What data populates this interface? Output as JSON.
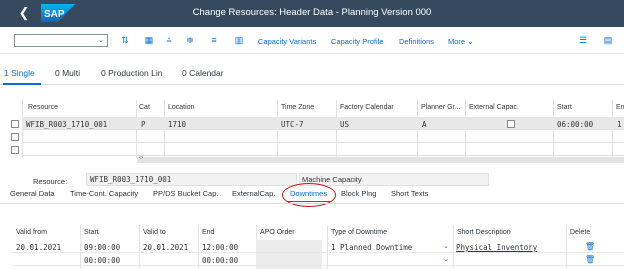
{
  "shell": {
    "title": "Change Resources: Header Data - Planning Version 000",
    "logo_text": "SAP"
  },
  "toolbar": {
    "combo_value": "",
    "capacity_variants": "Capacity Variants",
    "capacity_profile": "Capacity Profile",
    "definitions": "Definitions",
    "more": "More"
  },
  "count_tabs": [
    {
      "label": "1 Single"
    },
    {
      "label": "0 Multi"
    },
    {
      "label": "0 Production Lin"
    },
    {
      "label": "0 Calendar"
    }
  ],
  "grid": {
    "headers": [
      "Resource",
      "Cat",
      "Location",
      "Time Zone",
      "Factory Calendar",
      "Planner Gr...",
      "External Capac.",
      "Start",
      "En"
    ],
    "rows": [
      {
        "resource": "WFIB_R003_1710_001",
        "cat": "P",
        "location": "1710",
        "tz": "UTC-7",
        "calendar": "US",
        "planner": "A",
        "start": "06:00:00",
        "end": "1"
      }
    ]
  },
  "resource_line": {
    "label": "Resource:",
    "value": "WFIB_R003_1710_001",
    "description": "Machine Capacity"
  },
  "detail_tabs": [
    {
      "label": "General Data"
    },
    {
      "label": "Time-Cont. Capacity"
    },
    {
      "label": "PP/DS Bucket Cap."
    },
    {
      "label": "ExternalCap."
    },
    {
      "label": "Downtimes"
    },
    {
      "label": "Block Plng"
    },
    {
      "label": "Short Texts"
    }
  ],
  "downtimes": {
    "headers": [
      "Valid from",
      "Start",
      "Valid to",
      "End",
      "APO Order",
      "Type of Downtime",
      "Short Description",
      "Delete"
    ],
    "rows": [
      {
        "valid_from": "20.01.2021",
        "start": "09:00:00",
        "valid_to": "20.01.2021",
        "end": "12:00:00",
        "type": "1 Planned Downtime",
        "desc": "Physical Inventory"
      },
      {
        "valid_from": "",
        "start": "00:00:00",
        "valid_to": "",
        "end": "00:00:00",
        "type": "",
        "desc": ""
      }
    ]
  },
  "colors": {
    "shell": "#354a5f",
    "accent": "#0a6ed1",
    "highlight_circle": "#c01818"
  }
}
